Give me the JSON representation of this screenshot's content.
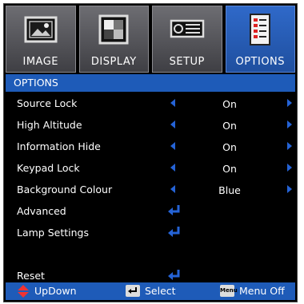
{
  "tabs": [
    {
      "label": "IMAGE",
      "icon": "image-icon",
      "active": false
    },
    {
      "label": "DISPLAY",
      "icon": "display-icon",
      "active": false
    },
    {
      "label": "SETUP",
      "icon": "projector-icon",
      "active": false
    },
    {
      "label": "OPTIONS",
      "icon": "options-icon",
      "active": true
    }
  ],
  "header": {
    "title": "OPTIONS"
  },
  "rows": [
    {
      "label": "Source Lock",
      "value": "On",
      "control": "arrows"
    },
    {
      "label": "High Altitude",
      "value": "On",
      "control": "arrows"
    },
    {
      "label": "Information Hide",
      "value": "On",
      "control": "arrows"
    },
    {
      "label": "Keypad Lock",
      "value": "On",
      "control": "arrows"
    },
    {
      "label": "Background Colour",
      "value": "Blue",
      "control": "arrows"
    },
    {
      "label": "Advanced",
      "control": "enter"
    },
    {
      "label": "Lamp Settings",
      "control": "enter"
    },
    {
      "label": "Reset",
      "control": "enter"
    }
  ],
  "footer": {
    "updown": "UpDown",
    "select": "Select",
    "menu_off": "Menu Off",
    "menu_key": "Menu"
  },
  "colors": {
    "accent": "#1e5bb8",
    "arrow": "#2563d6",
    "background": "#000000"
  }
}
